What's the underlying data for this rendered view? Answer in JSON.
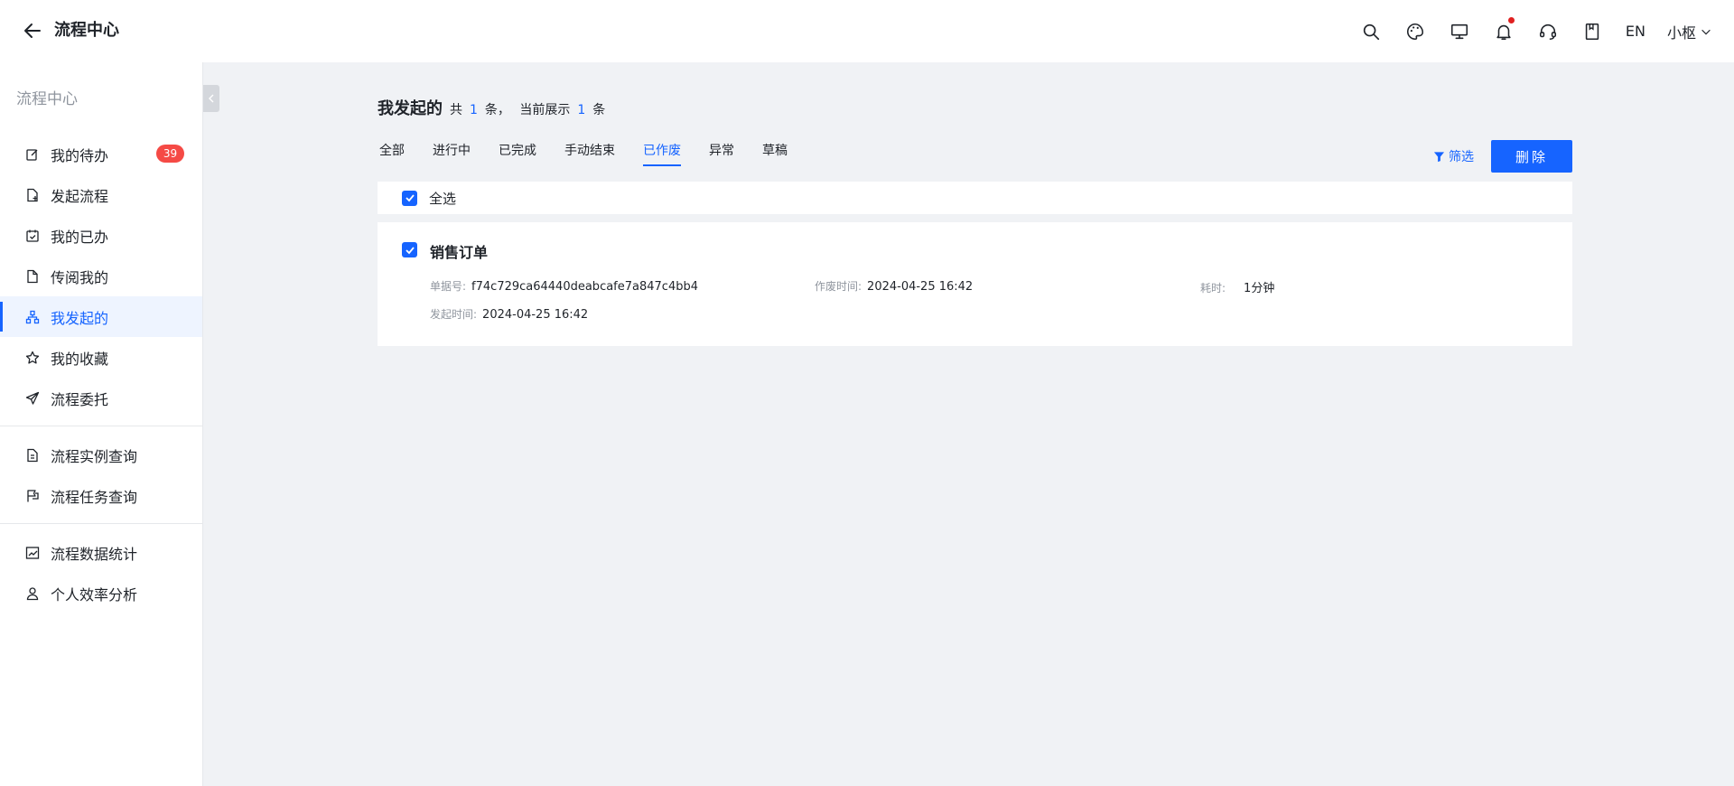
{
  "header": {
    "title": "流程中心",
    "lang": "EN",
    "user": "小枢"
  },
  "sidebar": {
    "title": "流程中心",
    "groups": [
      {
        "items": [
          {
            "label": "我的待办",
            "icon": "edit-icon",
            "badge": "39"
          },
          {
            "label": "发起流程",
            "icon": "file-add-icon"
          },
          {
            "label": "我的已办",
            "icon": "calendar-check-icon"
          },
          {
            "label": "传阅我的",
            "icon": "file-icon"
          },
          {
            "label": "我发起的",
            "icon": "sitemap-icon",
            "active": true
          },
          {
            "label": "我的收藏",
            "icon": "star-icon"
          },
          {
            "label": "流程委托",
            "icon": "send-icon"
          }
        ]
      },
      {
        "items": [
          {
            "label": "流程实例查询",
            "icon": "file-search-icon"
          },
          {
            "label": "流程任务查询",
            "icon": "flag-icon"
          }
        ]
      },
      {
        "items": [
          {
            "label": "流程数据统计",
            "icon": "chart-icon"
          },
          {
            "label": "个人效率分析",
            "icon": "user-icon"
          }
        ]
      }
    ]
  },
  "main": {
    "title": "我发起的",
    "total_prefix": "共",
    "total": "1",
    "total_suffix": "条，",
    "showing_prefix": "当前展示",
    "showing": "1",
    "showing_suffix": "条",
    "tabs": [
      "全部",
      "进行中",
      "已完成",
      "手动结束",
      "已作废",
      "异常",
      "草稿"
    ],
    "active_tab": "已作废",
    "filter_label": "筛选",
    "delete_label": "删除",
    "select_all_label": "全选",
    "card": {
      "title": "销售订单",
      "order_no_label": "单据号:",
      "order_no": "f74c729ca64440deabcafe7a847c4bb4",
      "void_time_label": "作废时间:",
      "void_time": "2024-04-25 16:42",
      "duration_label": "耗时:",
      "duration": "1分钟",
      "start_time_label": "发起时间:",
      "start_time": "2024-04-25 16:42"
    }
  },
  "colors": {
    "accent": "#1664ff",
    "badge": "#f54a45",
    "background": "#f0f2f5"
  }
}
